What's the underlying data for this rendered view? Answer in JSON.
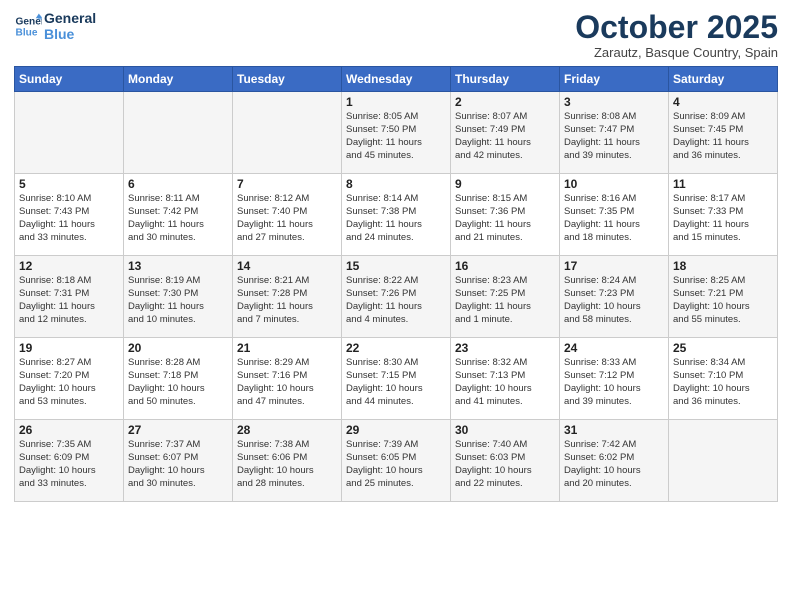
{
  "logo": {
    "line1": "General",
    "line2": "Blue"
  },
  "header": {
    "month": "October 2025",
    "location": "Zarautz, Basque Country, Spain"
  },
  "weekdays": [
    "Sunday",
    "Monday",
    "Tuesday",
    "Wednesday",
    "Thursday",
    "Friday",
    "Saturday"
  ],
  "weeks": [
    [
      {
        "day": "",
        "info": ""
      },
      {
        "day": "",
        "info": ""
      },
      {
        "day": "",
        "info": ""
      },
      {
        "day": "1",
        "info": "Sunrise: 8:05 AM\nSunset: 7:50 PM\nDaylight: 11 hours\nand 45 minutes."
      },
      {
        "day": "2",
        "info": "Sunrise: 8:07 AM\nSunset: 7:49 PM\nDaylight: 11 hours\nand 42 minutes."
      },
      {
        "day": "3",
        "info": "Sunrise: 8:08 AM\nSunset: 7:47 PM\nDaylight: 11 hours\nand 39 minutes."
      },
      {
        "day": "4",
        "info": "Sunrise: 8:09 AM\nSunset: 7:45 PM\nDaylight: 11 hours\nand 36 minutes."
      }
    ],
    [
      {
        "day": "5",
        "info": "Sunrise: 8:10 AM\nSunset: 7:43 PM\nDaylight: 11 hours\nand 33 minutes."
      },
      {
        "day": "6",
        "info": "Sunrise: 8:11 AM\nSunset: 7:42 PM\nDaylight: 11 hours\nand 30 minutes."
      },
      {
        "day": "7",
        "info": "Sunrise: 8:12 AM\nSunset: 7:40 PM\nDaylight: 11 hours\nand 27 minutes."
      },
      {
        "day": "8",
        "info": "Sunrise: 8:14 AM\nSunset: 7:38 PM\nDaylight: 11 hours\nand 24 minutes."
      },
      {
        "day": "9",
        "info": "Sunrise: 8:15 AM\nSunset: 7:36 PM\nDaylight: 11 hours\nand 21 minutes."
      },
      {
        "day": "10",
        "info": "Sunrise: 8:16 AM\nSunset: 7:35 PM\nDaylight: 11 hours\nand 18 minutes."
      },
      {
        "day": "11",
        "info": "Sunrise: 8:17 AM\nSunset: 7:33 PM\nDaylight: 11 hours\nand 15 minutes."
      }
    ],
    [
      {
        "day": "12",
        "info": "Sunrise: 8:18 AM\nSunset: 7:31 PM\nDaylight: 11 hours\nand 12 minutes."
      },
      {
        "day": "13",
        "info": "Sunrise: 8:19 AM\nSunset: 7:30 PM\nDaylight: 11 hours\nand 10 minutes."
      },
      {
        "day": "14",
        "info": "Sunrise: 8:21 AM\nSunset: 7:28 PM\nDaylight: 11 hours\nand 7 minutes."
      },
      {
        "day": "15",
        "info": "Sunrise: 8:22 AM\nSunset: 7:26 PM\nDaylight: 11 hours\nand 4 minutes."
      },
      {
        "day": "16",
        "info": "Sunrise: 8:23 AM\nSunset: 7:25 PM\nDaylight: 11 hours\nand 1 minute."
      },
      {
        "day": "17",
        "info": "Sunrise: 8:24 AM\nSunset: 7:23 PM\nDaylight: 10 hours\nand 58 minutes."
      },
      {
        "day": "18",
        "info": "Sunrise: 8:25 AM\nSunset: 7:21 PM\nDaylight: 10 hours\nand 55 minutes."
      }
    ],
    [
      {
        "day": "19",
        "info": "Sunrise: 8:27 AM\nSunset: 7:20 PM\nDaylight: 10 hours\nand 53 minutes."
      },
      {
        "day": "20",
        "info": "Sunrise: 8:28 AM\nSunset: 7:18 PM\nDaylight: 10 hours\nand 50 minutes."
      },
      {
        "day": "21",
        "info": "Sunrise: 8:29 AM\nSunset: 7:16 PM\nDaylight: 10 hours\nand 47 minutes."
      },
      {
        "day": "22",
        "info": "Sunrise: 8:30 AM\nSunset: 7:15 PM\nDaylight: 10 hours\nand 44 minutes."
      },
      {
        "day": "23",
        "info": "Sunrise: 8:32 AM\nSunset: 7:13 PM\nDaylight: 10 hours\nand 41 minutes."
      },
      {
        "day": "24",
        "info": "Sunrise: 8:33 AM\nSunset: 7:12 PM\nDaylight: 10 hours\nand 39 minutes."
      },
      {
        "day": "25",
        "info": "Sunrise: 8:34 AM\nSunset: 7:10 PM\nDaylight: 10 hours\nand 36 minutes."
      }
    ],
    [
      {
        "day": "26",
        "info": "Sunrise: 7:35 AM\nSunset: 6:09 PM\nDaylight: 10 hours\nand 33 minutes."
      },
      {
        "day": "27",
        "info": "Sunrise: 7:37 AM\nSunset: 6:07 PM\nDaylight: 10 hours\nand 30 minutes."
      },
      {
        "day": "28",
        "info": "Sunrise: 7:38 AM\nSunset: 6:06 PM\nDaylight: 10 hours\nand 28 minutes."
      },
      {
        "day": "29",
        "info": "Sunrise: 7:39 AM\nSunset: 6:05 PM\nDaylight: 10 hours\nand 25 minutes."
      },
      {
        "day": "30",
        "info": "Sunrise: 7:40 AM\nSunset: 6:03 PM\nDaylight: 10 hours\nand 22 minutes."
      },
      {
        "day": "31",
        "info": "Sunrise: 7:42 AM\nSunset: 6:02 PM\nDaylight: 10 hours\nand 20 minutes."
      },
      {
        "day": "",
        "info": ""
      }
    ]
  ]
}
